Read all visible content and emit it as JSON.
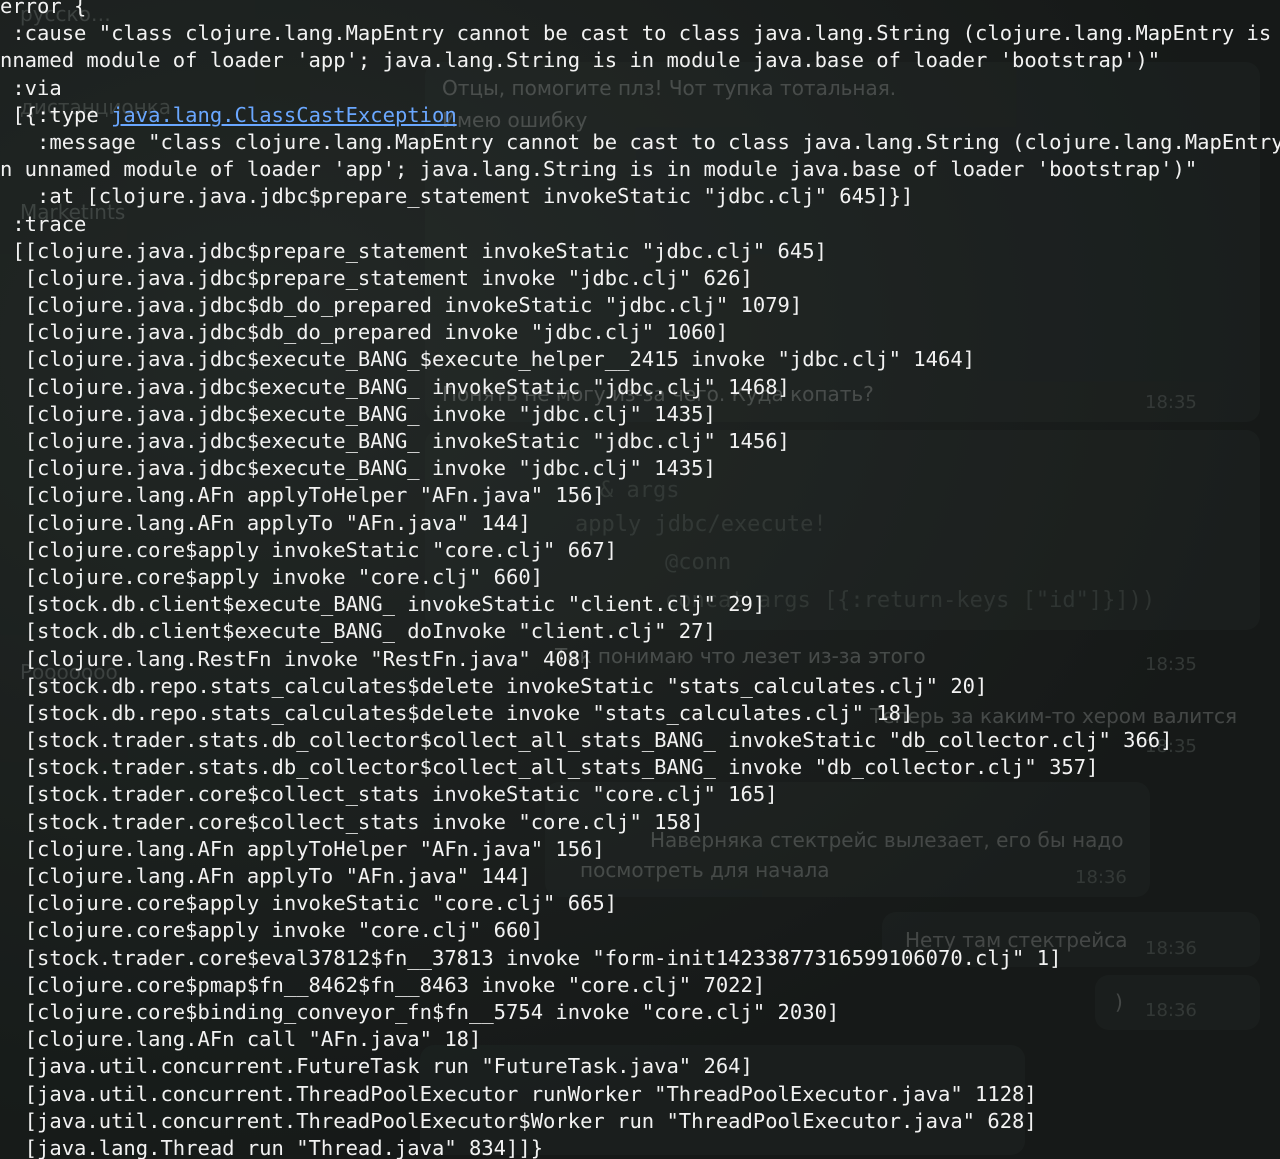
{
  "background_chat": {
    "sidebar_items": [
      "русско…",
      "дистанционка",
      "Marketints",
      "Рооооооо"
    ],
    "messages": [
      {
        "text": "Отцы, помогите плз! Чот тупка тотальная."
      },
      {
        "text": "Имею ошибку"
      },
      {
        "text": "Понять не могу из-за чего. Куда копать?",
        "time": "18:35"
      },
      {
        "text": "Так понимаю что лезет из-за этого",
        "time": "18:35"
      },
      {
        "text": "Теперь за каким-то хером валится",
        "time": "18:35"
      },
      {
        "text": "Наверняка стектрейс вылезает, его бы надо"
      },
      {
        "text": "посмотреть для начала",
        "time": "18:36"
      },
      {
        "text": "Нету там стектрейса",
        "time": "18:36"
      },
      {
        "text": ")",
        "time": "18:36"
      }
    ],
    "code_snippet": [
      "& args",
      "apply jdbc/execute!",
      "@conn",
      "concat args [{:return-keys [\"id\"]}]))"
    ],
    "accent_colors": {
      "bubble": "#2b3330",
      "link": "#6aa7ff",
      "text": "#f2f2f2"
    }
  },
  "stacktrace": {
    "lines": [
      "error {",
      " :cause \"class clojure.lang.MapEntry cannot be cast to class java.lang.String (clojure.lang.MapEntry is in u",
      "nnamed module of loader 'app'; java.lang.String is in module java.base of loader 'bootstrap')\"",
      " :via",
      " [{:type ",
      "   :message \"class clojure.lang.MapEntry cannot be cast to class java.lang.String (clojure.lang.MapEntry is",
      "n unnamed module of loader 'app'; java.lang.String is in module java.base of loader 'bootstrap')\"",
      "   :at [clojure.java.jdbc$prepare_statement invokeStatic \"jdbc.clj\" 645]}]",
      " :trace",
      " [[clojure.java.jdbc$prepare_statement invokeStatic \"jdbc.clj\" 645]",
      "  [clojure.java.jdbc$prepare_statement invoke \"jdbc.clj\" 626]",
      "  [clojure.java.jdbc$db_do_prepared invokeStatic \"jdbc.clj\" 1079]",
      "  [clojure.java.jdbc$db_do_prepared invoke \"jdbc.clj\" 1060]",
      "  [clojure.java.jdbc$execute_BANG_$execute_helper__2415 invoke \"jdbc.clj\" 1464]",
      "  [clojure.java.jdbc$execute_BANG_ invokeStatic \"jdbc.clj\" 1468]",
      "  [clojure.java.jdbc$execute_BANG_ invoke \"jdbc.clj\" 1435]",
      "  [clojure.java.jdbc$execute_BANG_ invokeStatic \"jdbc.clj\" 1456]",
      "  [clojure.java.jdbc$execute_BANG_ invoke \"jdbc.clj\" 1435]",
      "  [clojure.lang.AFn applyToHelper \"AFn.java\" 156]",
      "  [clojure.lang.AFn applyTo \"AFn.java\" 144]",
      "  [clojure.core$apply invokeStatic \"core.clj\" 667]",
      "  [clojure.core$apply invoke \"core.clj\" 660]",
      "  [stock.db.client$execute_BANG_ invokeStatic \"client.clj\" 29]",
      "  [stock.db.client$execute_BANG_ doInvoke \"client.clj\" 27]",
      "  [clojure.lang.RestFn invoke \"RestFn.java\" 408]",
      "  [stock.db.repo.stats_calculates$delete invokeStatic \"stats_calculates.clj\" 20]",
      "  [stock.db.repo.stats_calculates$delete invoke \"stats_calculates.clj\" 18]",
      "  [stock.trader.stats.db_collector$collect_all_stats_BANG_ invokeStatic \"db_collector.clj\" 366]",
      "  [stock.trader.stats.db_collector$collect_all_stats_BANG_ invoke \"db_collector.clj\" 357]",
      "  [stock.trader.core$collect_stats invokeStatic \"core.clj\" 165]",
      "  [stock.trader.core$collect_stats invoke \"core.clj\" 158]",
      "  [clojure.lang.AFn applyToHelper \"AFn.java\" 156]",
      "  [clojure.lang.AFn applyTo \"AFn.java\" 144]",
      "  [clojure.core$apply invokeStatic \"core.clj\" 665]",
      "  [clojure.core$apply invoke \"core.clj\" 660]",
      "  [stock.trader.core$eval37812$fn__37813 invoke \"form-init14233877316599106070.clj\" 1]",
      "  [clojure.core$pmap$fn__8462$fn__8463 invoke \"core.clj\" 7022]",
      "  [clojure.core$binding_conveyor_fn$fn__5754 invoke \"core.clj\" 2030]",
      "  [clojure.lang.AFn call \"AFn.java\" 18]",
      "  [java.util.concurrent.FutureTask run \"FutureTask.java\" 264]",
      "  [java.util.concurrent.ThreadPoolExecutor runWorker \"ThreadPoolExecutor.java\" 1128]",
      "  [java.util.concurrent.ThreadPoolExecutor$Worker run \"ThreadPoolExecutor.java\" 628]",
      "  [java.lang.Thread run \"Thread.java\" 834]]}"
    ],
    "via_type_link": "java.lang.ClassCastException"
  }
}
